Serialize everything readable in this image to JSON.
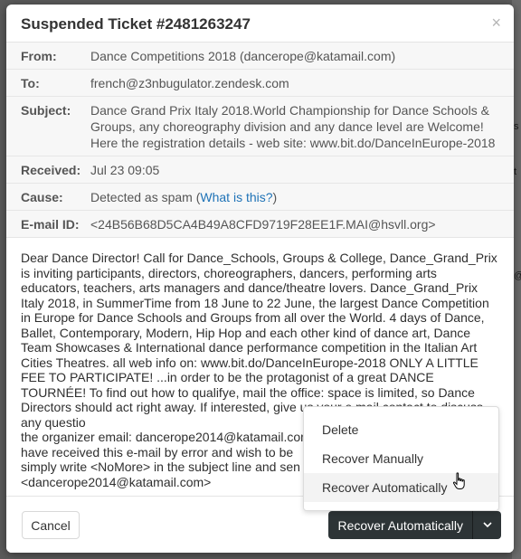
{
  "modal": {
    "title": "Suspended Ticket #2481263247",
    "close_glyph": "×"
  },
  "meta": [
    {
      "label": "From:",
      "value": "Dance Competitions 2018 (dancerope@katamail.com)"
    },
    {
      "label": "To:",
      "value": "french@z3nbugulator.zendesk.com"
    },
    {
      "label": "Subject:",
      "value": "Dance Grand Prix Italy 2018.World Championship for Dance Schools & Groups, any choreography division and any dance level are Welcome! Here the registration details - web site: www.bit.do/DanceInEurope-2018"
    },
    {
      "label": "Received:",
      "value": "Jul 23 09:05"
    },
    {
      "label": "Cause:",
      "value": "Detected as spam (",
      "link": "What is this?",
      "suffix": ")"
    },
    {
      "label": "E-mail ID:",
      "value": "<24B56B68D5CA4B49A8CFD9719F28EE1F.MAI@hsvll.org>"
    }
  ],
  "body_text": "Dear Dance Director! Call for Dance_Schools, Groups & College, Dance_Grand_Prix is inviting participants, directors, choreographers, dancers, performing arts educators, teachers, arts managers and dance/theatre lovers. Dance_Grand_Prix Italy 2018, in SummerTime from 18 June to 22 June, the largest Dance Competition in Europe for Dance Schools and Groups from all over the World. 4 days of Dance, Ballet, Contemporary, Modern, Hip Hop and each other kind of dance art, Dance Team Showcases & International dance performance competition in the Italian Art Cities Theatres. all web info on: www.bit.do/DanceInEurope-2018 ONLY A LITTLE FEE TO PARTICIPATE! ...in order to be the protagonist of a great DANCE TOURNÉE! To find out how to qualifye, mail the office: space is limited, so Dance Directors should act right away. If interested, give us your e.mail contact to discuss any questio\nthe organizer email: dancerope2014@katamail.con\nhave received this e-mail by error and wish to be\nsimply write <NoMore> in the subject line and sen\n<dancerope2014@katamail.com>",
  "footer": {
    "cancel_label": "Cancel",
    "primary_label": "Recover Automatically"
  },
  "dropdown": {
    "items": [
      "Delete",
      "Recover Manually",
      "Recover Automatically"
    ],
    "active_index": 2
  },
  "icons": {
    "caret": "chevron-down-icon",
    "cursor": "hand-pointer-icon"
  }
}
